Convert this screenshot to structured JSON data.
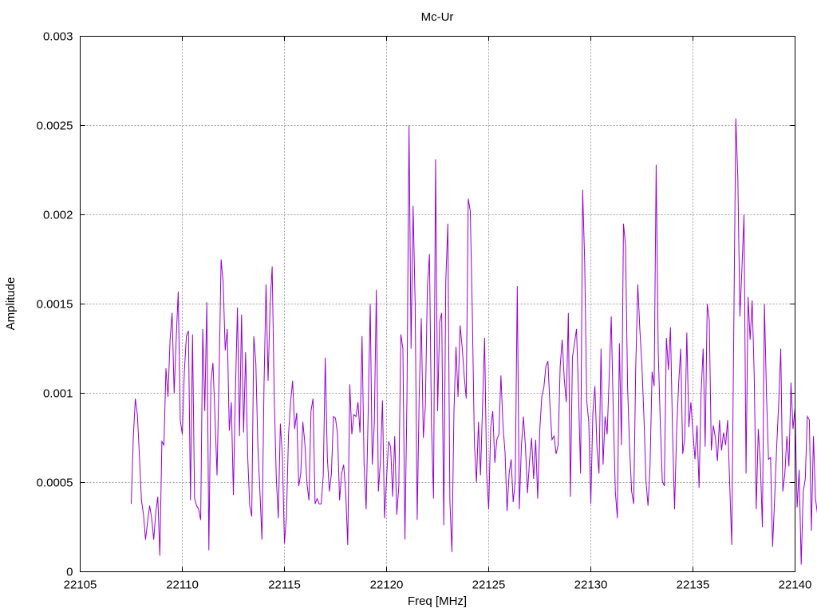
{
  "colors": {
    "series": "#9400d3",
    "frame": "#000000",
    "grid": "#a0a0a0",
    "background": "#ffffff"
  },
  "chart_data": {
    "type": "line",
    "title": "Mc-Ur",
    "xlabel": "Freq [MHz]",
    "ylabel": "Amplitude",
    "xlim": [
      22105,
      22140
    ],
    "ylim": [
      0,
      0.003
    ],
    "x_ticks": [
      "22105",
      "22110",
      "22115",
      "22120",
      "22125",
      "22130",
      "22135",
      "22140"
    ],
    "y_ticks": [
      "0",
      "0.0005",
      "0.001",
      "0.0015",
      "0.002",
      "0.0025",
      "0.003"
    ],
    "grid": true,
    "legend": "none",
    "series": [
      {
        "x_start": 22107.5,
        "x_step": 0.1,
        "values": [
          0.00038,
          0.00075,
          0.00097,
          0.00088,
          0.00065,
          0.0004,
          0.00032,
          0.00018,
          0.00028,
          0.00037,
          0.0003,
          0.00018,
          0.00033,
          0.00042,
          9e-05,
          0.00073,
          0.00071,
          0.00114,
          0.00098,
          0.0013,
          0.00145,
          0.001,
          0.0013,
          0.00157,
          0.00085,
          0.00077,
          0.00112,
          0.00132,
          0.00135,
          0.0004,
          0.00133,
          0.00041,
          0.00037,
          0.00035,
          0.00029,
          0.00136,
          0.0009,
          0.00151,
          0.00012,
          0.00106,
          0.00117,
          0.00087,
          0.00054,
          0.0011,
          0.00175,
          0.00162,
          0.00124,
          0.00136,
          0.00079,
          0.00095,
          0.00043,
          0.00101,
          0.00148,
          0.00076,
          0.00144,
          0.00078,
          0.00123,
          0.00065,
          0.00037,
          0.00031,
          0.00132,
          0.00117,
          0.0007,
          0.00045,
          0.00018,
          0.00104,
          0.00161,
          0.00107,
          0.0015,
          0.00171,
          0.00099,
          0.00053,
          0.0003,
          0.00083,
          0.00065,
          0.00016,
          0.00031,
          0.00077,
          0.00095,
          0.00107,
          0.0008,
          0.00089,
          0.00048,
          0.00055,
          0.00084,
          0.00072,
          0.0005,
          0.0004,
          0.0009,
          0.00097,
          0.00038,
          0.00041,
          0.00038,
          0.00038,
          0.00054,
          0.0012,
          0.00064,
          0.00045,
          0.00055,
          0.00087,
          0.00086,
          0.00077,
          0.0004,
          0.00055,
          0.0006,
          0.00044,
          0.00015,
          0.00105,
          0.00077,
          0.00088,
          0.00087,
          0.00095,
          0.00078,
          0.00132,
          0.0006,
          0.00035,
          0.00089,
          0.0015,
          0.0006,
          0.00083,
          0.00158,
          0.00045,
          0.00062,
          0.00096,
          0.0003,
          0.00052,
          0.00073,
          0.0007,
          0.00042,
          0.00076,
          0.00032,
          0.00048,
          0.00133,
          0.00125,
          0.00018,
          0.00098,
          0.0025,
          0.00125,
          0.00205,
          0.0015,
          0.00029,
          0.001,
          0.00142,
          0.00075,
          0.00093,
          0.0016,
          0.00178,
          0.00082,
          0.00041,
          0.00231,
          0.0009,
          0.0014,
          0.00145,
          0.00026,
          0.00163,
          0.00195,
          0.0004,
          0.00011,
          0.0009,
          0.00126,
          0.00098,
          0.00138,
          0.00126,
          0.0011,
          0.00097,
          0.00209,
          0.00202,
          0.00144,
          0.00072,
          0.0005,
          0.00084,
          0.00054,
          0.00093,
          0.00131,
          0.00055,
          0.00035,
          0.00081,
          0.0009,
          0.00061,
          0.00074,
          0.00077,
          0.0011,
          0.00082,
          0.00067,
          0.00034,
          0.00055,
          0.00063,
          0.00039,
          0.00051,
          0.0016,
          0.00035,
          0.0007,
          0.00087,
          0.0007,
          0.00044,
          0.00062,
          0.00075,
          0.00052,
          0.00074,
          0.00041,
          0.00079,
          0.00098,
          0.00103,
          0.00115,
          0.00118,
          0.00093,
          0.00074,
          0.00076,
          0.00066,
          0.00071,
          0.00115,
          0.0013,
          0.00108,
          0.00095,
          0.00145,
          0.00042,
          0.0012,
          0.00128,
          0.00136,
          0.00099,
          0.00055,
          0.00214,
          0.00174,
          0.00096,
          0.00084,
          0.00038,
          0.00089,
          0.00104,
          0.0007,
          0.00055,
          0.00125,
          0.0006,
          0.00087,
          0.00077,
          0.00109,
          0.00143,
          0.0009,
          0.00045,
          0.0003,
          0.00128,
          0.00071,
          0.00195,
          0.00183,
          0.00104,
          0.00069,
          0.00045,
          0.00038,
          0.00115,
          0.00161,
          0.00136,
          0.00116,
          0.00087,
          0.00051,
          0.00037,
          0.00059,
          0.00112,
          0.00104,
          0.00228,
          0.00124,
          0.00084,
          0.00051,
          0.00048,
          0.00131,
          0.00113,
          0.00137,
          0.00079,
          0.00035,
          0.00078,
          0.00105,
          0.00125,
          0.00066,
          0.00075,
          0.00134,
          0.00081,
          0.00095,
          0.00078,
          0.00063,
          0.00082,
          0.00047,
          0.001,
          0.00125,
          0.0007,
          0.0015,
          0.00141,
          0.00068,
          0.00082,
          0.00075,
          0.00062,
          0.00085,
          0.00068,
          0.00078,
          0.00071,
          0.00085,
          0.00049,
          0.00015,
          0.00136,
          0.00254,
          0.0022,
          0.00143,
          0.0017,
          0.002,
          0.00055,
          0.00154,
          0.0013,
          0.00152,
          0.0011,
          0.00035,
          0.0008,
          0.00061,
          0.00025,
          0.0015,
          0.001,
          0.00063,
          0.00064,
          0.00014,
          0.00041,
          0.0007,
          0.00095,
          0.00125,
          0.00045,
          0.00055,
          0.00076,
          0.00059,
          0.00106,
          0.0008,
          0.00092,
          0.00036,
          0.00057,
          4e-05,
          0.00045,
          0.00052,
          0.00087,
          0.00085,
          0.00023,
          0.00076,
          0.00041,
          0.00032,
          0.00077,
          0.00018,
          0.00082,
          0.00037,
          0.0009,
          0.00035,
          0.00089,
          0.00042,
          0.00055,
          0.00089,
          0.00068,
          0.001,
          0.0003,
          0.00083,
          0.0012,
          0.0008,
          0.0005,
          0.00025,
          0.00055,
          0.0009,
          0.00056,
          0.0006,
          0.00044,
          0.00106,
          0.00075,
          0.00086,
          0.001,
          0.0011,
          0.00098,
          0.00048,
          0.00047,
          0.00084,
          0.0016,
          0.00069,
          0.00056,
          0.00037,
          0.00016,
          0.00064,
          0.00046,
          0.0012,
          0.00105,
          0.0009,
          0.00115,
          0.00078,
          0.00052,
          0.0007,
          0.00063,
          0.00043,
          0.00075,
          0.00062,
          0.00073,
          0.00058,
          0.00044,
          0.00035,
          0.00064,
          0.00088,
          0.00102,
          0.00085,
          0.00067,
          0.00048,
          0.00053,
          0.00039,
          0.00068,
          0.00072,
          0.00061,
          0.00033,
          0.00075,
          0.00094,
          0.0008,
          0.00049,
          0.00038,
          0.00045,
          0.0005,
          0.00055,
          0.00041,
          0.0006,
          0.00037,
          0.00048,
          0.00114,
          0.00113,
          0.0011,
          0.00104,
          0.00163,
          0.0012,
          0.00049,
          0.00022,
          0.0001,
          0.00064,
          0.00104,
          0.00062,
          0.0003,
          0.00023,
          0.00013,
          5e-05,
          0.00018,
          0.00055,
          0.00027,
          0.0001,
          0.00018,
          0.00018
        ]
      }
    ]
  }
}
